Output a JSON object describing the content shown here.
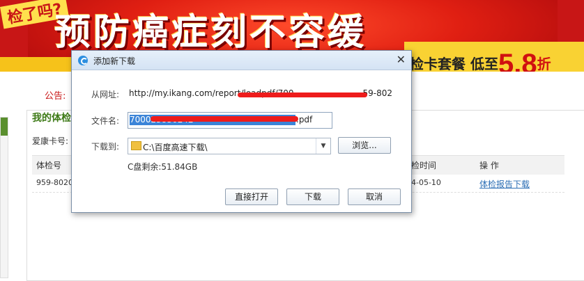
{
  "banner": {
    "tag": "检了吗?",
    "slogan": "预防癌症刻不容缓",
    "promo_prefix": "检卡套餐 低至",
    "promo_value": "5.8",
    "promo_suffix": "折"
  },
  "page": {
    "notice_label": "公告:",
    "section_title": "我的体检",
    "card_label": "爱康卡号:",
    "table": {
      "headers": [
        "体检号",
        "检时间",
        "操 作"
      ],
      "row": {
        "exam_no": "959-8020",
        "date": "4-05-10",
        "action": "体检报告下载"
      }
    }
  },
  "dialog": {
    "title": "添加新下载",
    "close_glyph": "✕",
    "url_label": "从网址:",
    "url_value": "http://my.ikang.com/report/loadpdf/700",
    "url_tail": "59-802",
    "filename_label": "文件名:",
    "filename_selected": "700023830242",
    "filename_ext": ".pdf",
    "saveto_label": "下载到:",
    "saveto_value": "C:\\百度高速下载\\",
    "browse_button": "浏览...",
    "disk_info": "C盘剩余:51.84GB",
    "open_button": "直接打开",
    "download_button": "下载",
    "cancel_button": "取消"
  },
  "colors": {
    "banner_red": "#c81616",
    "accent_blue": "#3b84d8",
    "redaction_red": "#ee1c1c",
    "title_green": "#3d7a16",
    "link_blue": "#2d6fb5"
  }
}
